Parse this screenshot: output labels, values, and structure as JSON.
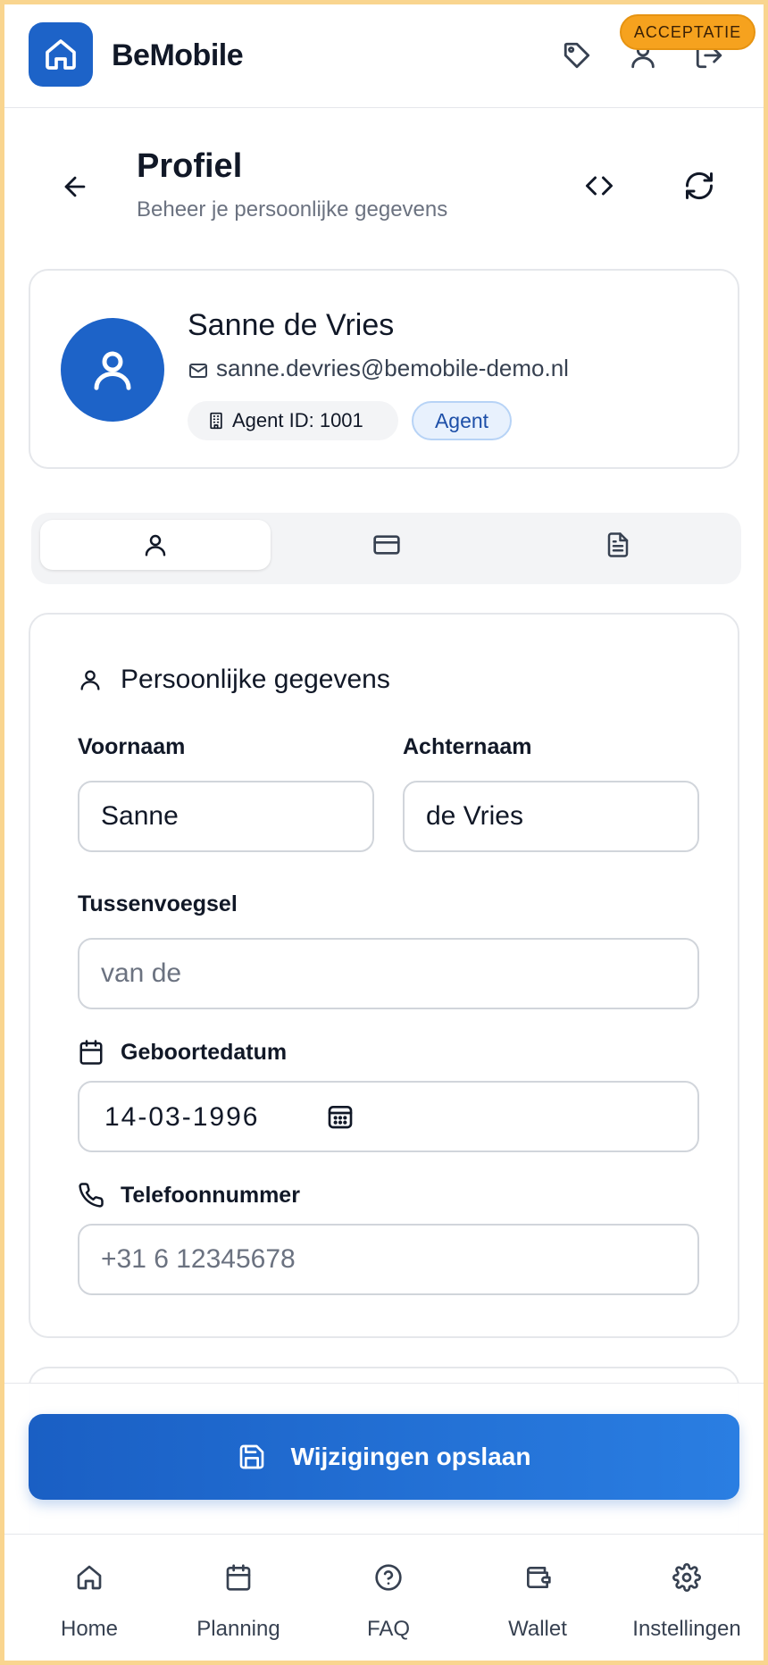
{
  "header": {
    "brand": "BeMobile",
    "environment_badge": "ACCEPTATIE"
  },
  "page": {
    "title": "Profiel",
    "subtitle": "Beheer je persoonlijke gegevens"
  },
  "profile": {
    "name": "Sanne de Vries",
    "email": "sanne.devries@bemobile-demo.nl",
    "agent_id": "Agent ID: 1001",
    "role": "Agent"
  },
  "tabs": [
    {
      "icon": "user-icon",
      "active": true
    },
    {
      "icon": "credit-card-icon",
      "active": false
    },
    {
      "icon": "document-icon",
      "active": false
    }
  ],
  "form": {
    "section_title": "Persoonlijke gegevens",
    "first_name": {
      "label": "Voornaam",
      "value": "Sanne"
    },
    "last_name": {
      "label": "Achternaam",
      "value": "de Vries"
    },
    "infix": {
      "label": "Tussenvoegsel",
      "value": "",
      "placeholder": "van de"
    },
    "birthdate": {
      "label": "Geboortedatum",
      "value": "14-03-1996"
    },
    "phone": {
      "label": "Telefoonnummer",
      "value": "",
      "placeholder": "+31 6 12345678"
    }
  },
  "actions": {
    "save_label": "Wijzigingen opslaan"
  },
  "nav": [
    {
      "label": "Home",
      "icon": "home-icon"
    },
    {
      "label": "Planning",
      "icon": "calendar-icon"
    },
    {
      "label": "FAQ",
      "icon": "help-circle-icon"
    },
    {
      "label": "Wallet",
      "icon": "wallet-icon"
    },
    {
      "label": "Instellingen",
      "icon": "gear-icon"
    }
  ],
  "colors": {
    "primary": "#1d63c8",
    "badge": "#f6a21e",
    "frame": "#f9d58f"
  }
}
